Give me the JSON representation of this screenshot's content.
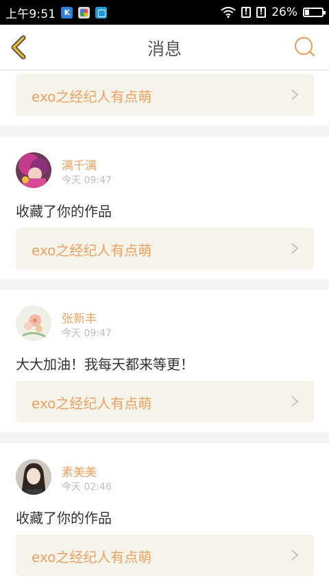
{
  "status_bar": {
    "time": "上午9:51",
    "app_icon_k": "K",
    "battery_percent": "26%",
    "battery_level": 0.26
  },
  "header": {
    "title": "消息"
  },
  "work_title": "exo之经纪人有点萌",
  "messages": [
    {
      "username": "漓千漓",
      "time": "今天 09:47",
      "text": "收藏了你的作品",
      "work": "exo之经纪人有点萌"
    },
    {
      "username": "张新丰",
      "time": "今天 09:47",
      "text": "大大加油！我每天都来等更！",
      "work": "exo之经纪人有点萌"
    },
    {
      "username": "素美美",
      "time": "今天 02:46",
      "text": "收藏了你的作品",
      "work": "exo之经纪人有点萌"
    }
  ],
  "colors": {
    "accent": "#f0a05e",
    "link_bg": "#f4f4eb",
    "back_arrow": "#e7b733"
  }
}
